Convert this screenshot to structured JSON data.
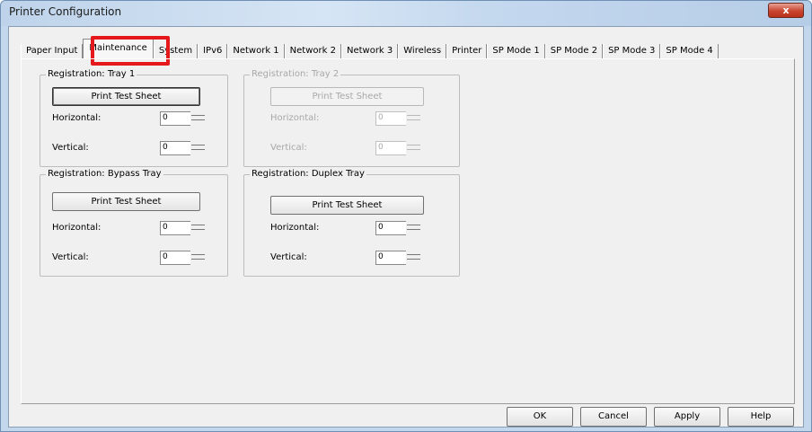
{
  "window": {
    "title": "Printer Configuration",
    "close_label": "x"
  },
  "tabs": [
    {
      "label": "Paper Input"
    },
    {
      "label": "Maintenance"
    },
    {
      "label": "System"
    },
    {
      "label": "IPv6"
    },
    {
      "label": "Network 1"
    },
    {
      "label": "Network 2"
    },
    {
      "label": "Network 3"
    },
    {
      "label": "Wireless"
    },
    {
      "label": "Printer"
    },
    {
      "label": "SP Mode 1"
    },
    {
      "label": "SP Mode 2"
    },
    {
      "label": "SP Mode 3"
    },
    {
      "label": "SP Mode 4"
    }
  ],
  "groups": {
    "tray1": {
      "title": "Registration: Tray 1",
      "button": "Print Test Sheet",
      "horizontal_label": "Horizontal:",
      "horizontal_value": "0",
      "vertical_label": "Vertical:",
      "vertical_value": "0"
    },
    "tray2": {
      "title": "Registration: Tray 2",
      "button": "Print Test Sheet",
      "horizontal_label": "Horizontal:",
      "horizontal_value": "0",
      "vertical_label": "Vertical:",
      "vertical_value": "0"
    },
    "bypass": {
      "title": "Registration: Bypass Tray",
      "button": "Print Test Sheet",
      "horizontal_label": "Horizontal:",
      "horizontal_value": "0",
      "vertical_label": "Vertical:",
      "vertical_value": "0"
    },
    "duplex": {
      "title": "Registration: Duplex Tray",
      "button": "Print Test Sheet",
      "horizontal_label": "Horizontal:",
      "horizontal_value": "0",
      "vertical_label": "Vertical:",
      "vertical_value": "0"
    }
  },
  "buttons": {
    "ok": "OK",
    "cancel": "Cancel",
    "apply": "Apply",
    "help": "Help"
  },
  "colors": {
    "highlight": "#e5191b"
  }
}
